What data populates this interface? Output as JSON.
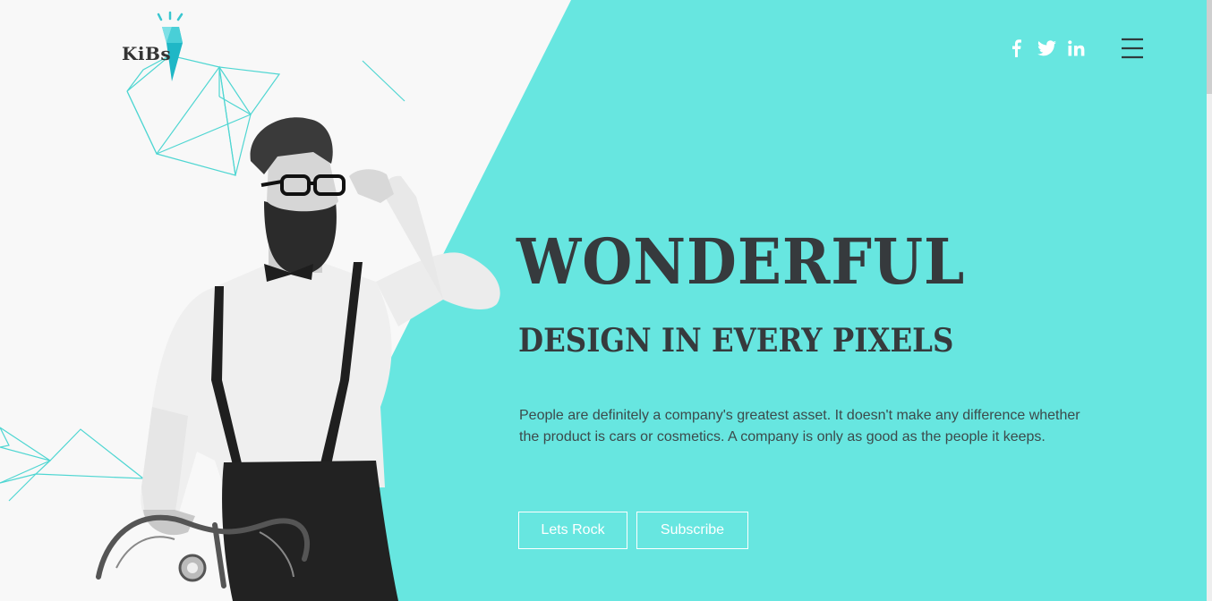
{
  "brand": {
    "logo_text": "KiBs"
  },
  "header": {
    "social": [
      {
        "icon": "facebook-icon",
        "label": "f"
      },
      {
        "icon": "twitter-icon",
        "label": "twitter"
      },
      {
        "icon": "linkedin-icon",
        "label": "in"
      }
    ],
    "menu_icon": "hamburger-menu-icon"
  },
  "hero": {
    "title": "WONDERFUL",
    "subtitle": "DESIGN IN EVERY PIXELS",
    "description": "People are definitely a company's greatest asset. It doesn't make any difference whether the product is cars or cosmetics. A company is only as good as the people it keeps.",
    "primary_button": "Lets Rock",
    "secondary_button": "Subscribe"
  },
  "colors": {
    "teal": "#67e6e0",
    "background": "#f8f8f8",
    "text_dark": "#363a3d",
    "accent_line": "#4fd6d2"
  }
}
